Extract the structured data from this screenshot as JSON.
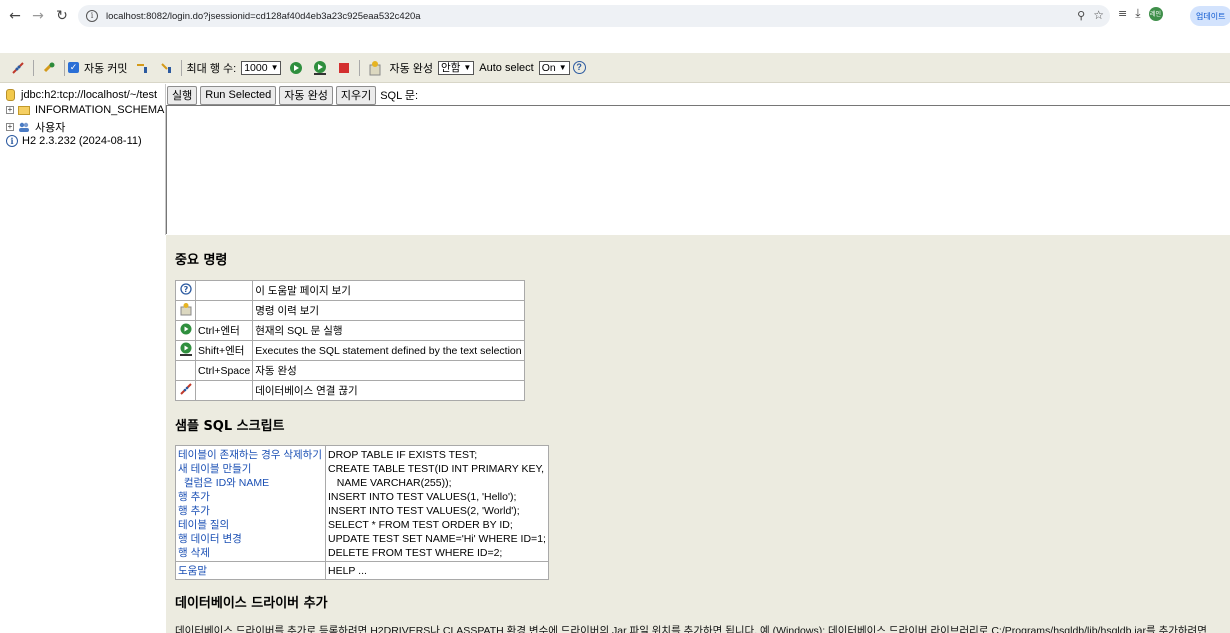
{
  "browser": {
    "url": "localhost:8082/login.do?jsessionid=cd128af40d4eb3a23c925eaa532c420a",
    "profile_label": "레인",
    "update_label": "업데이트"
  },
  "toolbar": {
    "autocommit_label": "자동 커밋",
    "max_rows_label": "최대 행 수:",
    "max_rows_value": "1000",
    "autocomplete_label": "자동 완성",
    "autocomplete_value": "안함",
    "auto_select_label": "Auto select",
    "auto_select_value": "On"
  },
  "tree": {
    "connection": "jdbc:h2:tcp://localhost/~/test",
    "schema": "INFORMATION_SCHEMA",
    "users": "사용자",
    "version": "H2 2.3.232 (2024-08-11)"
  },
  "query": {
    "run_label": "실행",
    "run_selected_label": "Run Selected",
    "autocomplete_label": "자동 완성",
    "clear_label": "지우기",
    "sql_label": "SQL 문:"
  },
  "help": {
    "important_title": "중요 명령",
    "commands": [
      {
        "icon": "help-icon",
        "key": "",
        "desc": "이 도움말 페이지 보기"
      },
      {
        "icon": "history-icon",
        "key": "",
        "desc": "명령 이력 보기"
      },
      {
        "icon": "run-icon",
        "key": "Ctrl+엔터",
        "desc": "현재의 SQL 문 실행"
      },
      {
        "icon": "run-selected-icon",
        "key": "Shift+엔터",
        "desc": "Executes the SQL statement defined by the text selection"
      },
      {
        "icon": "",
        "key": "Ctrl+Space",
        "desc": "자동 완성"
      },
      {
        "icon": "disconnect-icon",
        "key": "",
        "desc": "데이터베이스 연결 끊기"
      }
    ],
    "sample_title": "샘플 SQL 스크립트",
    "samples": [
      {
        "label": "테이블이 존재하는 경우 삭제하기",
        "sql": "DROP TABLE IF EXISTS TEST;"
      },
      {
        "label": "새 테이블 만들기",
        "sql": "CREATE TABLE TEST(ID INT PRIMARY KEY,"
      },
      {
        "label": "  컬럼은 ID와 NAME",
        "sql": "   NAME VARCHAR(255));"
      },
      {
        "label": "행 추가",
        "sql": "INSERT INTO TEST VALUES(1, 'Hello');"
      },
      {
        "label": "행 추가",
        "sql": "INSERT INTO TEST VALUES(2, 'World');"
      },
      {
        "label": "테이블 질의",
        "sql": "SELECT * FROM TEST ORDER BY ID;"
      },
      {
        "label": "행 데이터 변경",
        "sql": "UPDATE TEST SET NAME='Hi' WHERE ID=1;"
      },
      {
        "label": "행 삭제",
        "sql": "DELETE FROM TEST WHERE ID=2;"
      }
    ],
    "help_row": {
      "label": "도움말",
      "sql": "HELP ..."
    },
    "driver_title": "데이터베이스 드라이버 추가",
    "driver_text": "데이터베이스 드라이버를 추가로 등록하려면 H2DRIVERS나 CLASSPATH 환경 변수에 드라이버의 Jar 파일 위치를 추가하면 됩니다. 예 (Windows): 데이터베이스 드라이버 라이브러리로 C:/Programs/hsqldb/lib/hsqldb.jar를 추가하려면"
  }
}
